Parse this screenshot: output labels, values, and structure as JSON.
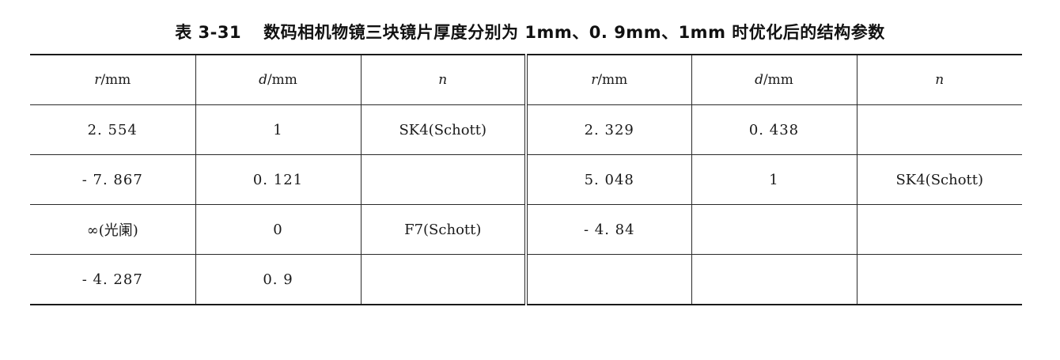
{
  "caption": {
    "number": "表 3-31",
    "title": "数码相机物镜三块镜片厚度分别为 1mm、0. 9mm、1mm 时优化后的结构参数"
  },
  "table": {
    "headers": [
      {
        "var": "r",
        "unit": "/mm"
      },
      {
        "var": "d",
        "unit": "/mm"
      },
      {
        "var": "n",
        "unit": ""
      },
      {
        "var": "r",
        "unit": "/mm"
      },
      {
        "var": "d",
        "unit": "/mm"
      },
      {
        "var": "n",
        "unit": ""
      }
    ],
    "rows": [
      [
        "2. 554",
        "1",
        "SK4(Schott)",
        "2. 329",
        "0. 438",
        ""
      ],
      [
        "- 7. 867",
        "0. 121",
        "",
        "5. 048",
        "1",
        "SK4(Schott)"
      ],
      [
        "∞(光阑)",
        "0",
        "F7(Schott)",
        "- 4. 84",
        "",
        ""
      ],
      [
        "- 4. 287",
        "0. 9",
        "",
        "",
        "",
        ""
      ]
    ]
  }
}
